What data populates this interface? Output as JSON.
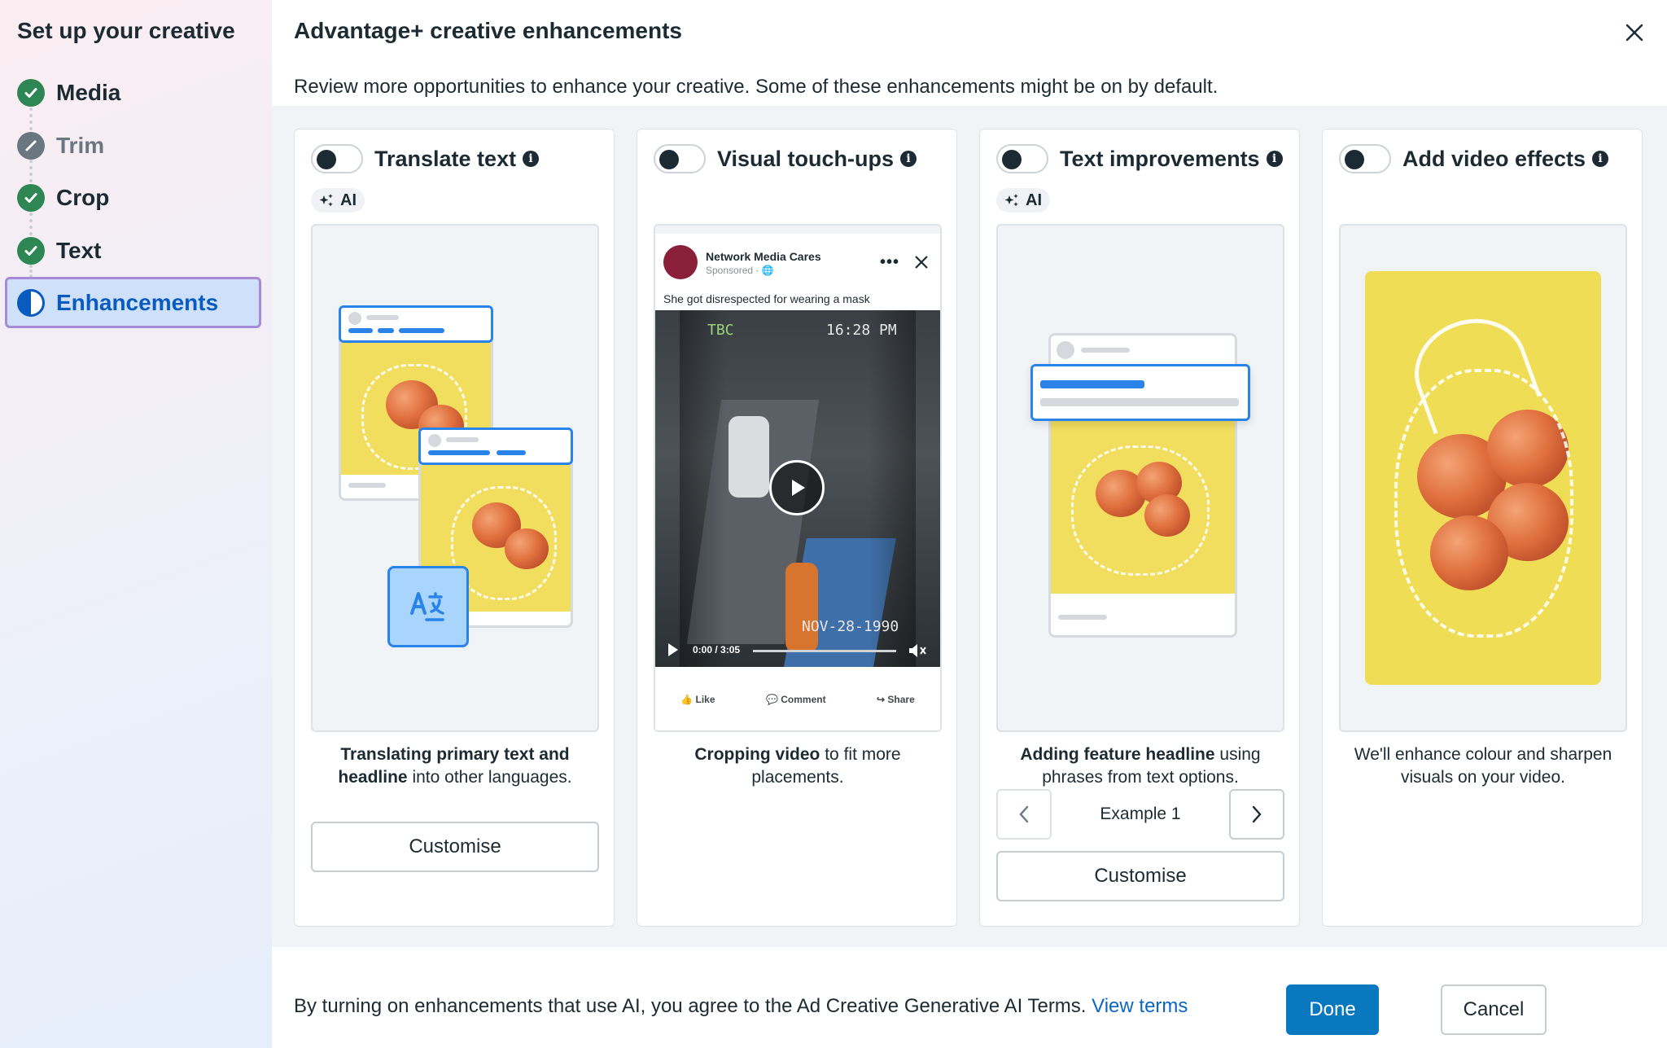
{
  "sidebar": {
    "title": "Set up your creative",
    "steps": [
      {
        "label": "Media",
        "state": "done"
      },
      {
        "label": "Trim",
        "state": "skipped"
      },
      {
        "label": "Crop",
        "state": "done"
      },
      {
        "label": "Text",
        "state": "done"
      },
      {
        "label": "Enhancements",
        "state": "active"
      }
    ]
  },
  "header": {
    "title": "Advantage+ creative enhancements",
    "subtitle": "Review more opportunities to enhance your creative. Some of these enhancements might be on by default."
  },
  "cards": [
    {
      "title": "Translate text",
      "ai_badge": "AI",
      "toggle_on": false,
      "desc_bold1": "Translating primary text and headline",
      "desc_rest": " into other languages.",
      "button": "Customise"
    },
    {
      "title": "Visual touch-ups",
      "toggle_on": false,
      "desc_bold1": "Cropping video",
      "desc_rest": " to fit more placements.",
      "preview": {
        "page_name": "Network Media Cares",
        "sponsored": "Sponsored · ",
        "caption": "She got disrespected for wearing a mask",
        "overlay_top_left": "TBC",
        "overlay_top_right": "16:28 PM",
        "overlay_bottom": "NOV-28-1990",
        "time": "0:00 / 3:05",
        "actions": [
          "Like",
          "Comment",
          "Share"
        ]
      }
    },
    {
      "title": "Text improvements",
      "ai_badge": "AI",
      "toggle_on": false,
      "desc_bold1": "Adding feature headline",
      "desc_rest": " using phrases from text options.",
      "pager_label": "Example 1",
      "button": "Customise"
    },
    {
      "title": "Add video effects",
      "toggle_on": false,
      "desc_bold1": "",
      "desc_rest": "We'll enhance colour and sharpen visuals on your video."
    }
  ],
  "footer": {
    "text": "By turning on enhancements that use AI, you agree to the Ad Creative Generative AI Terms. ",
    "link": "View terms",
    "cancel": "Cancel",
    "done": "Done"
  },
  "colors": {
    "accent": "#0a78be",
    "success": "#2d8653",
    "link": "#0a66c2"
  }
}
